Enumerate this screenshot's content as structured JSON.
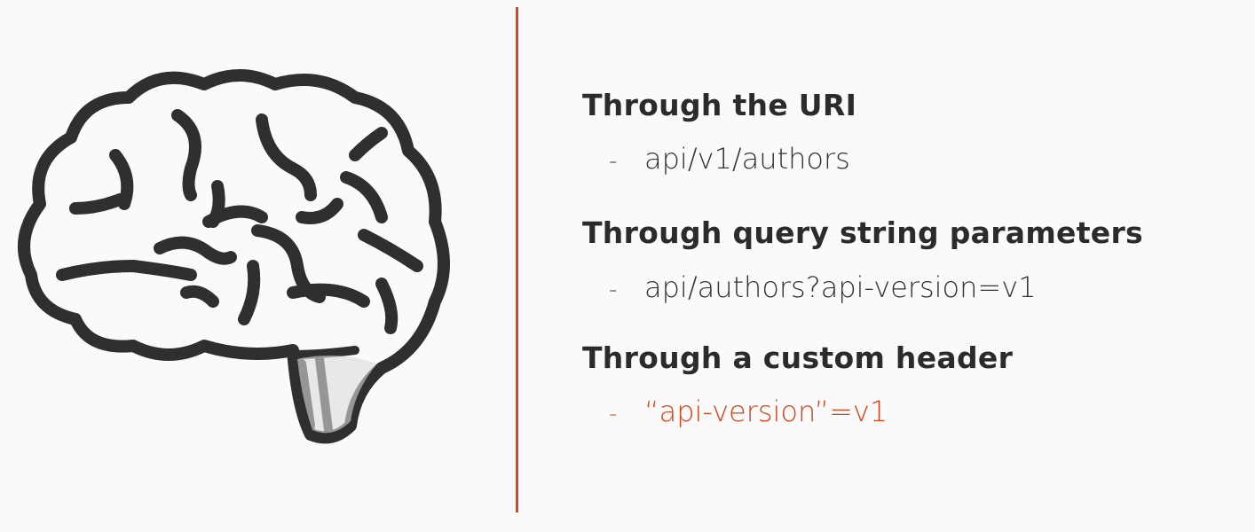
{
  "illustration": {
    "icon": "brain-icon",
    "stroke_color": "#2f2f2f"
  },
  "divider_color": "#d04a1f",
  "accent_color": "#d3441c",
  "sections": [
    {
      "heading": "Through the URI",
      "bullet": "-",
      "item": "api/v1/authors"
    },
    {
      "heading": "Through query string parameters",
      "bullet": "-",
      "item": "api/authors?api-version=v1"
    },
    {
      "heading": "Through a custom header",
      "bullet": "-",
      "item": "“api-version”=v1",
      "highlighted": true
    }
  ]
}
